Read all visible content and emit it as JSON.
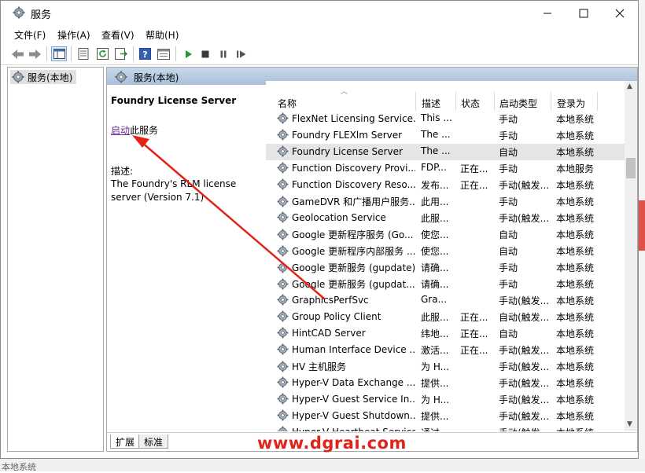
{
  "window": {
    "title": "服务",
    "controls": [
      "minimize-icon",
      "maximize-icon",
      "close-icon"
    ]
  },
  "menu": [
    "文件(F)",
    "操作(A)",
    "查看(V)",
    "帮助(H)"
  ],
  "toolbar_icons": [
    "back-icon",
    "forward-icon",
    "show-hide-tree-icon",
    "properties-icon",
    "refresh-icon",
    "export-list-icon",
    "help-icon",
    "view-icon",
    "start-service-icon",
    "stop-service-icon",
    "pause-service-icon",
    "restart-service-icon"
  ],
  "tree": {
    "selected": "服务(本地)"
  },
  "panel": {
    "header": "服务(本地)",
    "service_name": "Foundry License Server",
    "start_link": "启动",
    "start_suffix": "此服务",
    "description_label": "描述:",
    "description": "The Foundry's RLM license server (Version 7.1)"
  },
  "list": {
    "columns": [
      "名称",
      "描述",
      "状态",
      "启动类型",
      "登录为"
    ],
    "rows": [
      {
        "name": "FlexNet Licensing Service...",
        "desc": "This ...",
        "status": "",
        "startup": "手动",
        "logon": "本地系统"
      },
      {
        "name": "Foundry FLEXlm Server",
        "desc": "The ...",
        "status": "",
        "startup": "手动",
        "logon": "本地系统"
      },
      {
        "name": "Foundry License Server",
        "desc": "The ...",
        "status": "",
        "startup": "自动",
        "logon": "本地系统",
        "selected": true
      },
      {
        "name": "Function Discovery Provi...",
        "desc": "FDP...",
        "status": "正在...",
        "startup": "手动",
        "logon": "本地服务"
      },
      {
        "name": "Function Discovery Reso...",
        "desc": "发布...",
        "status": "正在...",
        "startup": "手动(触发...",
        "logon": "本地系统"
      },
      {
        "name": "GameDVR 和广播用户服务...",
        "desc": "此用...",
        "status": "",
        "startup": "手动",
        "logon": "本地系统"
      },
      {
        "name": "Geolocation Service",
        "desc": "此服...",
        "status": "",
        "startup": "手动(触发...",
        "logon": "本地系统"
      },
      {
        "name": "Google 更新程序服务 (Go...",
        "desc": "使您...",
        "status": "",
        "startup": "自动",
        "logon": "本地系统"
      },
      {
        "name": "Google 更新程序内部服务 ...",
        "desc": "使您...",
        "status": "",
        "startup": "自动",
        "logon": "本地系统"
      },
      {
        "name": "Google 更新服务 (gupdate)",
        "desc": "请确...",
        "status": "",
        "startup": "手动",
        "logon": "本地系统"
      },
      {
        "name": "Google 更新服务 (gupdat...",
        "desc": "请确...",
        "status": "",
        "startup": "手动",
        "logon": "本地系统"
      },
      {
        "name": "GraphicsPerfSvc",
        "desc": "Gra...",
        "status": "",
        "startup": "手动(触发...",
        "logon": "本地系统"
      },
      {
        "name": "Group Policy Client",
        "desc": "此服...",
        "status": "正在...",
        "startup": "自动(触发...",
        "logon": "本地系统"
      },
      {
        "name": "HintCAD Server",
        "desc": "纬地...",
        "status": "正在...",
        "startup": "自动",
        "logon": "本地系统"
      },
      {
        "name": "Human Interface Device ...",
        "desc": "激活...",
        "status": "正在...",
        "startup": "手动(触发...",
        "logon": "本地系统"
      },
      {
        "name": "HV 主机服务",
        "desc": "为 H...",
        "status": "",
        "startup": "手动(触发...",
        "logon": "本地系统"
      },
      {
        "name": "Hyper-V Data Exchange ...",
        "desc": "提供...",
        "status": "",
        "startup": "手动(触发...",
        "logon": "本地系统"
      },
      {
        "name": "Hyper-V Guest Service In...",
        "desc": "为 H...",
        "status": "",
        "startup": "手动(触发...",
        "logon": "本地系统"
      },
      {
        "name": "Hyper-V Guest Shutdown...",
        "desc": "提供...",
        "status": "",
        "startup": "手动(触发...",
        "logon": "本地系统"
      },
      {
        "name": "Hyper-V Heartbeat Service",
        "desc": "通过...",
        "status": "",
        "startup": "手动(触发...",
        "logon": "本地系统"
      }
    ]
  },
  "tabs": [
    "扩展",
    "标准"
  ],
  "watermark": "www.dgrai.com",
  "background_fragment": "本地系统",
  "colors": {
    "header_band": "#b7cbe2",
    "link": "#6b2a90",
    "arrow": "#e2231a",
    "selected_row": "#e5e5e5"
  }
}
